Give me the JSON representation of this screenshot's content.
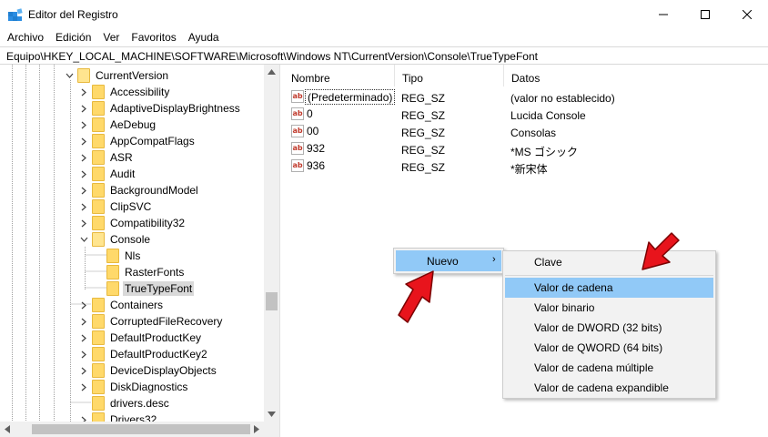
{
  "window": {
    "title": "Editor del Registro",
    "controls": [
      "minimize",
      "maximize",
      "close"
    ]
  },
  "menubar": [
    "Archivo",
    "Edición",
    "Ver",
    "Favoritos",
    "Ayuda"
  ],
  "address": "Equipo\\HKEY_LOCAL_MACHINE\\SOFTWARE\\Microsoft\\Windows NT\\CurrentVersion\\Console\\TrueTypeFont",
  "tree": {
    "items": [
      {
        "label": "CurrentVersion",
        "expanded": true
      },
      {
        "label": "Accessibility"
      },
      {
        "label": "AdaptiveDisplayBrightness"
      },
      {
        "label": "AeDebug"
      },
      {
        "label": "AppCompatFlags"
      },
      {
        "label": "ASR"
      },
      {
        "label": "Audit"
      },
      {
        "label": "BackgroundModel"
      },
      {
        "label": "ClipSVC"
      },
      {
        "label": "Compatibility32"
      },
      {
        "label": "Console",
        "expanded": true
      },
      {
        "label": "Nls"
      },
      {
        "label": "RasterFonts"
      },
      {
        "label": "TrueTypeFont",
        "selected": true
      },
      {
        "label": "Containers"
      },
      {
        "label": "CorruptedFileRecovery"
      },
      {
        "label": "DefaultProductKey"
      },
      {
        "label": "DefaultProductKey2"
      },
      {
        "label": "DeviceDisplayObjects"
      },
      {
        "label": "DiskDiagnostics"
      },
      {
        "label": "drivers.desc"
      },
      {
        "label": "Drivers32"
      }
    ]
  },
  "list": {
    "columns": [
      "Nombre",
      "Tipo",
      "Datos"
    ],
    "rows": [
      {
        "name": "(Predeterminado)",
        "type": "REG_SZ",
        "data": "(valor no establecido)",
        "icon": "ab-string-icon"
      },
      {
        "name": "0",
        "type": "REG_SZ",
        "data": "Lucida Console",
        "icon": "ab-string-icon"
      },
      {
        "name": "00",
        "type": "REG_SZ",
        "data": "Consolas",
        "icon": "ab-string-icon"
      },
      {
        "name": "932",
        "type": "REG_SZ",
        "data": "*MS ゴシック",
        "icon": "ab-string-icon"
      },
      {
        "name": "936",
        "type": "REG_SZ",
        "data": "*新宋体",
        "icon": "ab-string-icon"
      }
    ]
  },
  "context_menu": {
    "label": "Nuevo",
    "submenu_arrow": "›",
    "submenu": [
      "Clave",
      "Valor de cadena",
      "Valor binario",
      "Valor de DWORD (32 bits)",
      "Valor de QWORD (64 bits)",
      "Valor de cadena múltiple",
      "Valor de cadena expandible"
    ],
    "highlighted_item": "Valor de cadena"
  },
  "colors": {
    "highlight": "#91c9f7",
    "annotation_arrow": "#e8141c",
    "folder": "#ffd96a"
  }
}
